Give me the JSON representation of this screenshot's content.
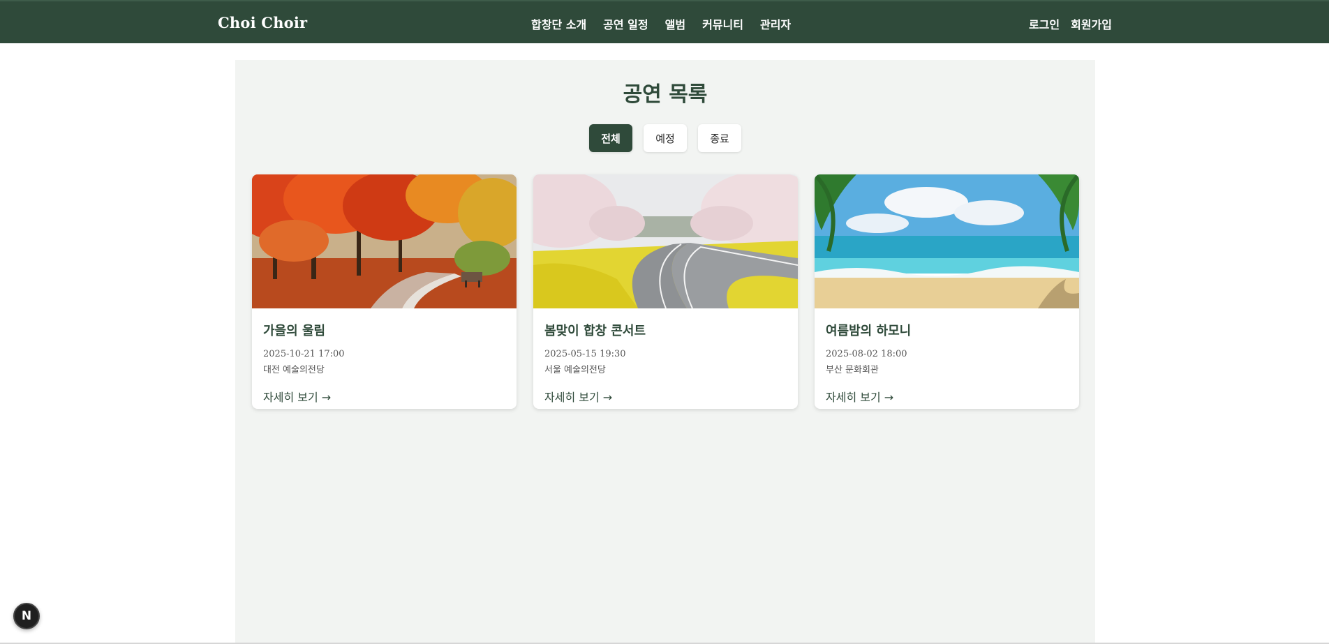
{
  "header": {
    "brand": "Choi Choir",
    "nav": [
      "합창단 소개",
      "공연 일정",
      "앨범",
      "커뮤니티",
      "관리자"
    ],
    "auth": {
      "login": "로그인",
      "signup": "회원가입"
    },
    "colors": {
      "primary": "#2f4a3a"
    }
  },
  "main": {
    "title": "공연 목록",
    "filters": [
      {
        "label": "전체",
        "active": true
      },
      {
        "label": "예정",
        "active": false
      },
      {
        "label": "종료",
        "active": false
      }
    ],
    "cards": [
      {
        "title": "가을의 울림",
        "date": "2025-10-21 17:00",
        "venue": "대전 예술의전당",
        "link": "자세히 보기 →",
        "image": "autumn-park-photo"
      },
      {
        "title": "봄맞이 합창 콘서트",
        "date": "2025-05-15 19:30",
        "venue": "서울 예술의전당",
        "link": "자세히 보기 →",
        "image": "spring-road-photo"
      },
      {
        "title": "여름밤의 하모니",
        "date": "2025-08-02 18:00",
        "venue": "부산 문화회관",
        "link": "자세히 보기 →",
        "image": "summer-beach-photo"
      }
    ]
  },
  "badge": {
    "label": "N"
  }
}
